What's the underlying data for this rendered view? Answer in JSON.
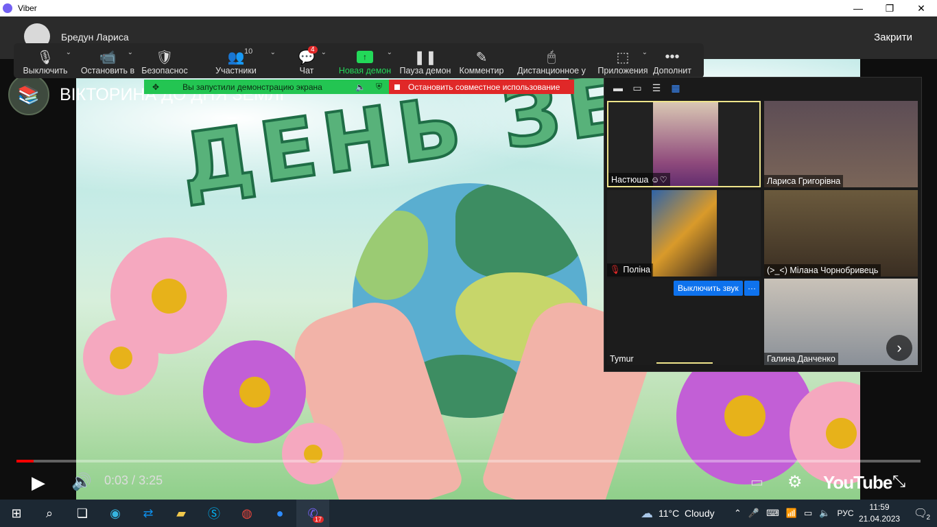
{
  "window": {
    "title": "Viber",
    "controls": [
      "—",
      "❐",
      "✕"
    ]
  },
  "chat_header": {
    "contact_name": "Бредун Лариса",
    "close_label": "Закрити"
  },
  "video": {
    "channel_icon": "books-logo-icon",
    "title": "ВІКТОРИНА ДО ДНЯ ЗЕМЛІ",
    "overlay_text": "ДЕНЬ ЗЕ",
    "time_current": "0:03",
    "time_separator": " / ",
    "time_total": "3:25",
    "progress_fraction": 0.019,
    "youtube_label": "YouTube"
  },
  "toolbar": {
    "items": [
      {
        "label": "Выключить",
        "icon": "microphone-icon",
        "glyph": "🎙",
        "caret": true
      },
      {
        "label": "Остановить в",
        "icon": "video-camera-icon",
        "glyph": "📹",
        "caret": true
      },
      {
        "label": "Безопаснос",
        "icon": "shield-icon",
        "glyph": "🛡",
        "caret": false
      },
      {
        "label": "Участники",
        "icon": "participants-icon",
        "glyph": "👥",
        "caret": true,
        "count": "10"
      },
      {
        "label": "Чат",
        "icon": "chat-bubble-icon",
        "glyph": "💬",
        "caret": true,
        "badge": "4"
      },
      {
        "label": "Новая демон",
        "icon": "share-screen-icon",
        "glyph": "↑",
        "caret": true,
        "accent": "#23d959"
      },
      {
        "label": "Пауза демон",
        "icon": "pause-icon",
        "glyph": "❚❚",
        "caret": false
      },
      {
        "label": "Комментир",
        "icon": "pen-icon",
        "glyph": "✎",
        "caret": false
      },
      {
        "label": "Дистанционное у",
        "icon": "mouse-icon",
        "glyph": "🖱",
        "caret": false
      },
      {
        "label": "Приложения",
        "icon": "apps-icon",
        "glyph": "⬚",
        "caret": true
      },
      {
        "label": "Дополнит",
        "icon": "more-dots-icon",
        "glyph": "•••",
        "caret": false
      }
    ]
  },
  "share_bar": {
    "status_text": "Вы запустили демонстрацию экрана",
    "stop_text": "Остановить совместное использование"
  },
  "gallery": {
    "view_buttons": [
      "▬",
      "▭",
      "☰",
      "▦"
    ],
    "participants": [
      {
        "name": "Настюша",
        "suffix": "☺♡",
        "muted": false,
        "active": true
      },
      {
        "name": "Лариса Григорівна",
        "muted": false
      },
      {
        "name": "Поліна",
        "muted": true
      },
      {
        "name": "(>_<) Мілана Чорнобривець",
        "muted": false
      },
      {
        "name": "Tymur",
        "muted": false
      },
      {
        "name": "Галина Данченко",
        "muted": false
      }
    ],
    "mute_button": "Выключить звук",
    "more_button": "···",
    "next_page": "›"
  },
  "taskbar": {
    "weather_temp": "11°C",
    "weather_text": "Cloudy",
    "lang": "РУС",
    "time": "11:59",
    "date": "21.04.2023",
    "viber_badge": "17",
    "notifications": "2"
  },
  "colors": {
    "zoom_green": "#23c552",
    "zoom_red": "#e02828",
    "youtube_red": "#ff0000",
    "active_border": "#f0e68c"
  }
}
